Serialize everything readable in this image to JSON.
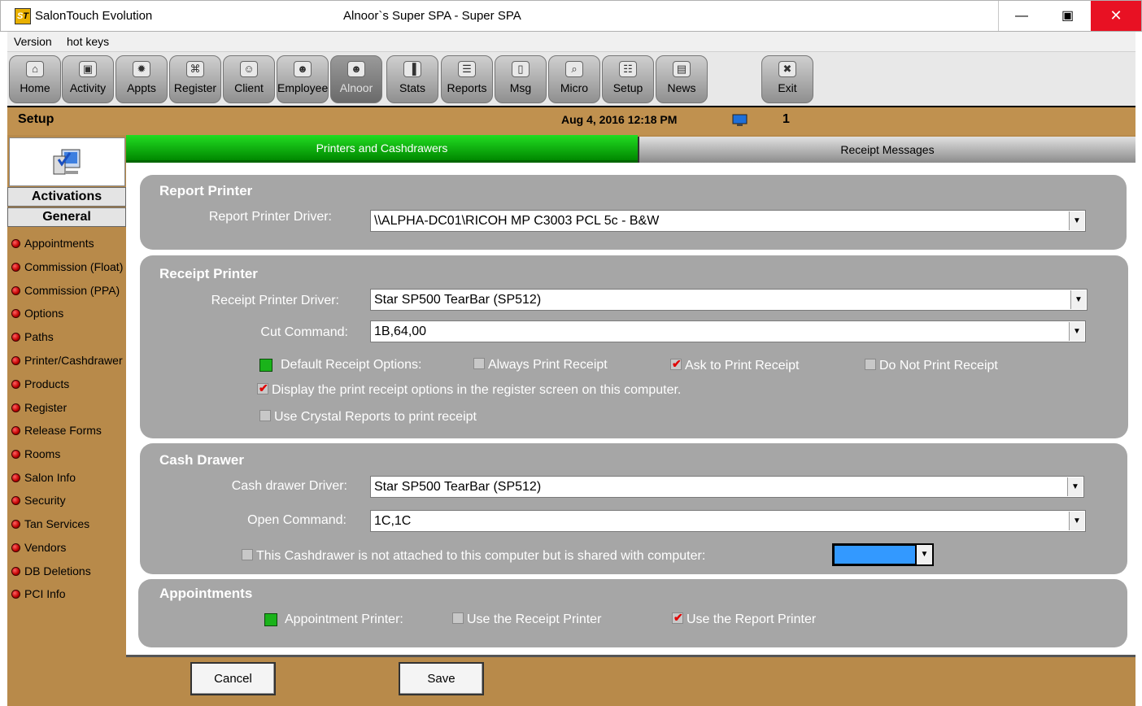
{
  "window": {
    "app_name": "SalonTouch Evolution",
    "title": "Alnoor`s Super SPA - Super SPA",
    "minimize": "—",
    "maximize": "▣",
    "close": "✕"
  },
  "menu": [
    "Version",
    "hot keys"
  ],
  "toolbar": [
    {
      "label": "Home",
      "icon": "home-icon",
      "glyph": "⌂"
    },
    {
      "label": "Activity",
      "icon": "activity-icon",
      "glyph": "▣"
    },
    {
      "label": "Appts",
      "icon": "appts-icon",
      "glyph": "✹"
    },
    {
      "label": "Register",
      "icon": "cart-icon",
      "glyph": "⌘"
    },
    {
      "label": "Client",
      "icon": "client-icon",
      "glyph": "☺"
    },
    {
      "label": "Employee",
      "icon": "employee-icon",
      "glyph": "☻"
    },
    {
      "label": "Alnoor",
      "icon": "user-icon",
      "glyph": "☻"
    },
    {
      "label": "Stats",
      "icon": "stats-icon",
      "glyph": "▐"
    },
    {
      "label": "Reports",
      "icon": "reports-icon",
      "glyph": "☰"
    },
    {
      "label": "Msg",
      "icon": "msg-icon",
      "glyph": "▯"
    },
    {
      "label": "Micro",
      "icon": "micro-icon",
      "glyph": "⌕"
    },
    {
      "label": "Setup",
      "icon": "setup-icon",
      "glyph": "☷"
    },
    {
      "label": "News",
      "icon": "news-icon",
      "glyph": "▤"
    },
    {
      "label": "Exit",
      "icon": "exit-icon",
      "glyph": "✖"
    }
  ],
  "header": {
    "section": "Setup",
    "date": "Aug  4,  2016  12:18 PM",
    "station": "1"
  },
  "sidebar": {
    "tabs": [
      "Activations",
      "General"
    ],
    "items": [
      "Appointments",
      "Commission (Float)",
      "Commission (PPA)",
      "Options",
      "Paths",
      "Printer/Cashdrawer",
      "Products",
      "Register",
      "Release Forms",
      "Rooms",
      "Salon Info",
      "Security",
      "Tan Services",
      "Vendors",
      "DB Deletions",
      "PCI Info"
    ]
  },
  "tabs": {
    "printers": "Printers and Cashdrawers",
    "receipt_messages": "Receipt Messages"
  },
  "report_printer": {
    "title": "Report Printer",
    "driver_label": "Report Printer Driver:",
    "driver_value": "\\\\ALPHA-DC01\\RICOH MP C3003 PCL 5c - B&W"
  },
  "receipt_printer": {
    "title": "Receipt Printer",
    "driver_label": "Receipt Printer Driver:",
    "driver_value": "Star SP500 TearBar (SP512)",
    "cut_label": "Cut Command:",
    "cut_value": "1B,64,00",
    "default_label": "Default Receipt Options:",
    "always": {
      "label": "Always Print Receipt",
      "checked": false
    },
    "ask": {
      "label": "Ask to Print Receipt",
      "checked": true
    },
    "do_not": {
      "label": "Do Not Print Receipt",
      "checked": false
    },
    "display_options": {
      "label": "Display the print receipt options in the register screen on this computer.",
      "checked": true
    },
    "crystal": {
      "label": "Use Crystal Reports to print receipt",
      "checked": false
    }
  },
  "cash_drawer": {
    "title": "Cash Drawer",
    "driver_label": "Cash drawer Driver:",
    "driver_value": "Star SP500 TearBar (SP512)",
    "open_label": "Open Command:",
    "open_value": "1C,1C",
    "shared": {
      "label": "This Cashdrawer is not attached to this computer but is shared with computer:",
      "checked": false
    },
    "shared_computer_value": ""
  },
  "appointments": {
    "title": "Appointments",
    "printer_label": "Appointment Printer:",
    "use_receipt": {
      "label": "Use the Receipt Printer",
      "checked": false
    },
    "use_report": {
      "label": "Use the Report Printer",
      "checked": true
    }
  },
  "buttons": {
    "cancel": "Cancel",
    "save": "Save"
  },
  "colors": {
    "accent_green": "#1ab31a",
    "frame": "#b88a4a",
    "panel": "#a6a6a6",
    "close": "#e81123"
  }
}
